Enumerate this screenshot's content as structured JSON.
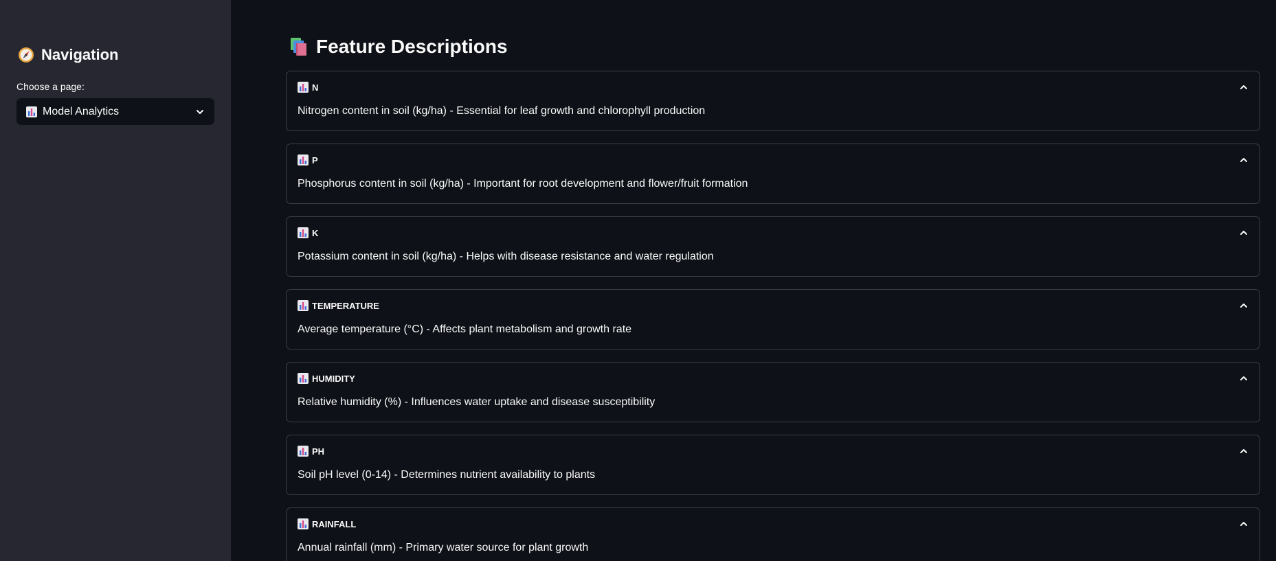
{
  "sidebar": {
    "title": "Navigation",
    "title_icon": "compass-icon",
    "select_label": "Choose a page:",
    "select_value": "Model Analytics",
    "select_icon": "bar-chart-icon"
  },
  "main": {
    "title": "Feature Descriptions",
    "title_icon": "books-icon",
    "features": [
      {
        "name": "N",
        "description": "Nitrogen content in soil (kg/ha) - Essential for leaf growth and chlorophyll production"
      },
      {
        "name": "P",
        "description": "Phosphorus content in soil (kg/ha) - Important for root development and flower/fruit formation"
      },
      {
        "name": "K",
        "description": "Potassium content in soil (kg/ha) - Helps with disease resistance and water regulation"
      },
      {
        "name": "TEMPERATURE",
        "description": "Average temperature (°C) - Affects plant metabolism and growth rate"
      },
      {
        "name": "HUMIDITY",
        "description": "Relative humidity (%) - Influences water uptake and disease susceptibility"
      },
      {
        "name": "PH",
        "description": "Soil pH level (0-14) - Determines nutrient availability to plants"
      },
      {
        "name": "RAINFALL",
        "description": "Annual rainfall (mm) - Primary water source for plant growth"
      }
    ]
  },
  "colors": {
    "sidebar_bg": "#262730",
    "main_bg": "#0e1117",
    "border": "#3b3e48",
    "text": "#fafafa"
  }
}
